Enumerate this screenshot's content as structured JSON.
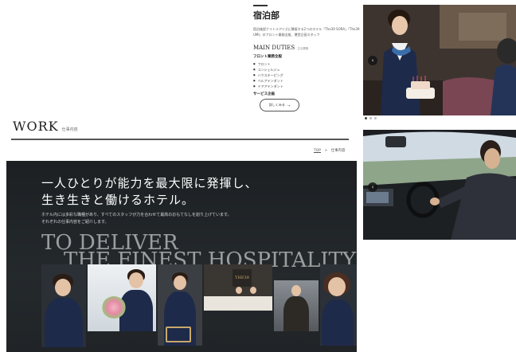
{
  "accommodation": {
    "title": "宿泊部",
    "description": "宿泊施設ナイトメアイズに隣接する2つのホテル「The39 SORA」「The39 UMI」のフロント業務全般、運営企画スタッフ",
    "main_duties_title": "MAIN DUTIES",
    "main_duties_sub": "主な業務",
    "front_label": "フロント業務全般",
    "duties": [
      "フロント",
      "コンシェルジュ",
      "ハウスキーピング",
      "ベルアテンダント",
      "ドアアテンダント"
    ],
    "service_label": "サービス企画",
    "more_button": "詳しくみる",
    "more_arrow": "→"
  },
  "carousel": {
    "prev_icon": "‹",
    "indicator_count": 3,
    "active_index": 0
  },
  "work": {
    "title": "WORK",
    "subtitle": "仕事内容"
  },
  "breadcrumb": {
    "home": "TOP",
    "separator": ">",
    "current": "仕事内容"
  },
  "hero": {
    "headline_line1": "一人ひとりが能力を最大限に発揮し、",
    "headline_line2": "生き生きと働けるホテル。",
    "lead_line1": "ホテル内には多彩な職種があり、すべてのスタッフが力を合わせて最高のおもてなしを創り上げています。",
    "lead_line2": "それぞれの仕事内容をご紹介します。",
    "big_line1": "TO DELIVER",
    "big_line2": "THE FINEST HOSPITALITY.",
    "sign_text": "THE39"
  },
  "colors": {
    "hero_bg": "#1f2326",
    "uniform_navy": "#1e2a4a",
    "accent_scarf": "#3b6ea8"
  }
}
